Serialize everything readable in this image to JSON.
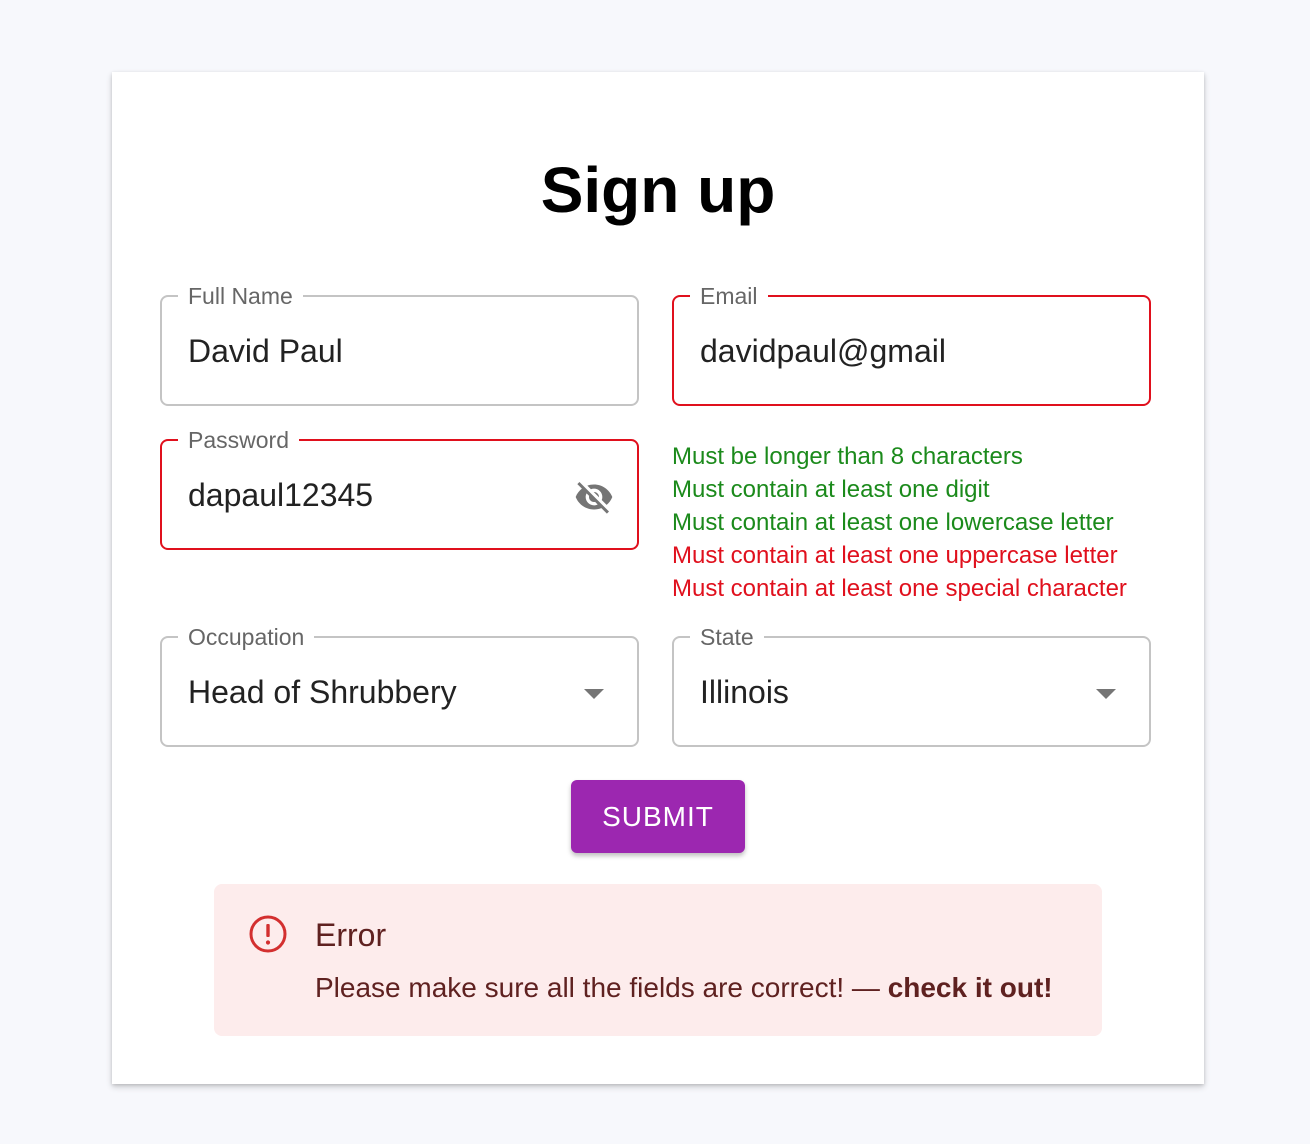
{
  "form": {
    "title": "Sign up",
    "full_name": {
      "label": "Full Name",
      "value": "David Paul"
    },
    "email": {
      "label": "Email",
      "value": "davidpaul@gmail"
    },
    "password": {
      "label": "Password",
      "value": "dapaul12345",
      "toggle_icon": "visibility-off-icon"
    },
    "password_rules": [
      {
        "text": "Must be longer than 8 characters",
        "status": "ok"
      },
      {
        "text": "Must contain at least one digit",
        "status": "ok"
      },
      {
        "text": "Must contain at least one lowercase letter",
        "status": "ok"
      },
      {
        "text": "Must contain at least one uppercase letter",
        "status": "fail"
      },
      {
        "text": "Must contain at least one special character",
        "status": "fail"
      }
    ],
    "occupation": {
      "label": "Occupation",
      "value": "Head of Shrubbery"
    },
    "state": {
      "label": "State",
      "value": "Illinois"
    },
    "submit_label": "SUBMIT"
  },
  "alert": {
    "title": "Error",
    "message": "Please make sure all the fields are correct! — ",
    "emphasis": "check it out!",
    "icon": "error-outline-icon"
  },
  "colors": {
    "error": "#e0101d",
    "success": "#1b8a1b",
    "accent": "#9c27b0",
    "alert_bg": "#fdecec",
    "alert_text": "#5f2120"
  }
}
